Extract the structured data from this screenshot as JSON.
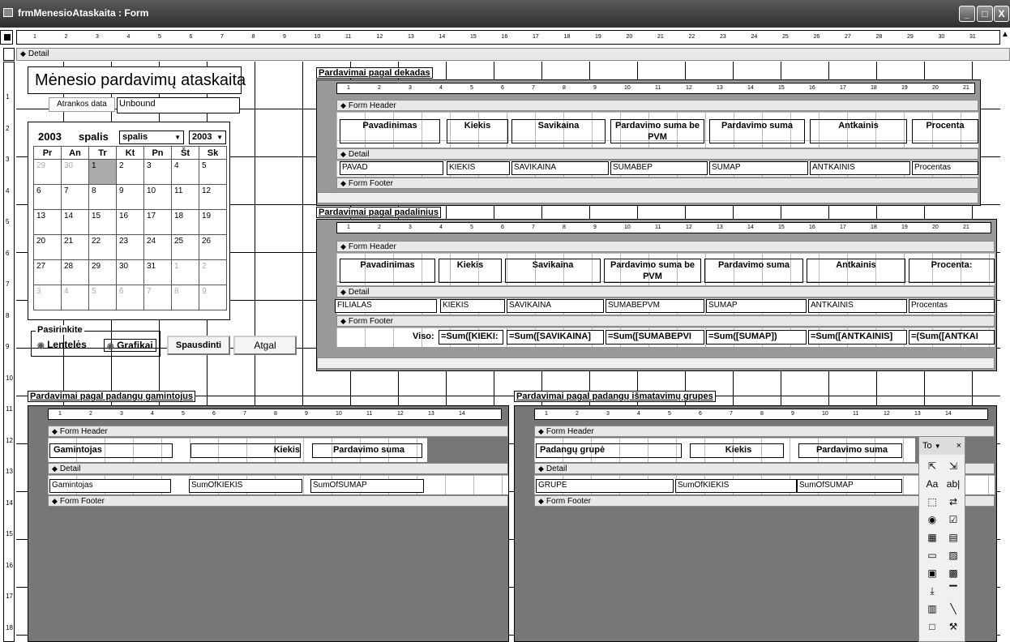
{
  "window": {
    "title": "frmMenesioAtaskaita : Form",
    "buttons": [
      "_",
      "□",
      "X"
    ]
  },
  "ruler_numbers": [
    "1",
    "2",
    "3",
    "4",
    "5",
    "6",
    "7",
    "8",
    "9",
    "10",
    "11",
    "12",
    "13",
    "14",
    "15",
    "16",
    "17",
    "18",
    "19",
    "20",
    "21",
    "22",
    "23",
    "24",
    "25",
    "26",
    "27",
    "28",
    "29",
    "30",
    "31"
  ],
  "vruler_numbers": [
    "1",
    "2",
    "3",
    "4",
    "5",
    "6",
    "7",
    "8",
    "9",
    "10",
    "11",
    "12",
    "13",
    "14",
    "15",
    "16",
    "17",
    "18"
  ],
  "sections": {
    "detail": "Detail",
    "form_header": "Form Header",
    "form_footer": "Form Footer"
  },
  "main": {
    "title": "Mėnesio pardavimų ataskaita",
    "date_label": "Atrankos data",
    "date_value": "Unbound",
    "calendar": {
      "year": "2003",
      "month": "spalis",
      "month_select": "spalis",
      "year_select": "2003",
      "weekdays": [
        "Pr",
        "An",
        "Tr",
        "Kt",
        "Pn",
        "Št",
        "Sk"
      ],
      "weeks": [
        [
          "29",
          "30",
          "1",
          "2",
          "3",
          "4",
          "5"
        ],
        [
          "6",
          "7",
          "8",
          "9",
          "10",
          "11",
          "12"
        ],
        [
          "13",
          "14",
          "15",
          "16",
          "17",
          "18",
          "19"
        ],
        [
          "20",
          "21",
          "22",
          "23",
          "24",
          "25",
          "26"
        ],
        [
          "27",
          "28",
          "29",
          "30",
          "31",
          "1",
          "2"
        ],
        [
          "3",
          "4",
          "5",
          "6",
          "7",
          "8",
          "9"
        ]
      ]
    },
    "option_group": {
      "label": "Pasirinkite",
      "options": [
        "Lentelės",
        "Grafikai"
      ]
    },
    "print_button": "Spausdinti",
    "back_button": "Atgal"
  },
  "subform_decades": {
    "caption": "Pardavimai pagal dekadas",
    "header_labels": [
      "Pavadinimas",
      "Kiekis",
      "Savikaina",
      "Pardavimo suma be PVM",
      "Pardavimo suma",
      "Antkainis",
      "Procenta"
    ],
    "detail_fields": [
      "PAVAD",
      "KIEKIS",
      "SAVIKAINA",
      "SUMABEP",
      "SUMAP",
      "ANTKAINIS",
      "Procentas"
    ]
  },
  "subform_branches": {
    "caption": "Pardavimai pagal padalinius",
    "header_labels": [
      "Pavadinimas",
      "Kiekis",
      "Savikaina",
      "Pardavimo suma be PVM",
      "Pardavimo suma",
      "Antkainis",
      "Procenta:"
    ],
    "detail_fields": [
      "FILIALAS",
      "KIEKIS",
      "SAVIKAINA",
      "SUMABEPVM",
      "SUMAP",
      "ANTKAINIS",
      "Procentas"
    ],
    "footer_label": "Viso:",
    "footer_fields": [
      "=Sum([KIEKI:",
      "=Sum([SAVIKAINA]",
      "=Sum([SUMABEPVI",
      "=Sum([SUMAP])",
      "=Sum([ANTKAINIS]",
      "=(Sum([ANTKAI"
    ]
  },
  "subform_manufacturer": {
    "caption": "Pardavimai pagal padangų gamintojus",
    "header_labels": [
      "Gamintojas",
      "Kiekis",
      "Pardavimo suma"
    ],
    "detail_fields": [
      "Gamintojas",
      "SumOfKIEKIS",
      "SumOfSUMAP"
    ]
  },
  "subform_size": {
    "caption": "Pardavimai pagal padangų išmatavimų grupes",
    "header_labels": [
      "Padangų grupė",
      "Kiekis",
      "Pardavimo suma"
    ],
    "detail_fields": [
      "GRUPE",
      "SumOfKIEKIS",
      "SumOfSUMAP"
    ]
  },
  "toolbox": {
    "title": "To",
    "close": "×",
    "tools": [
      "pointer-icon",
      "wizard-icon",
      "label-icon",
      "textbox-icon",
      "option-group-icon",
      "toggle-icon",
      "option-icon",
      "checkbox-icon",
      "combobox-icon",
      "listbox-icon",
      "command-button-icon",
      "image-icon",
      "unbound-object-icon",
      "bound-object-icon",
      "page-break-icon",
      "tab-control-icon",
      "subform-icon",
      "line-icon",
      "rectangle-icon",
      "more-controls-icon"
    ],
    "glyphs": [
      "⇱",
      "⇲",
      "Aa",
      "ab|",
      "⬚",
      "⇄",
      "◉",
      "☑",
      "▦",
      "▤",
      "▭",
      "▨",
      "▣",
      "▩",
      "⤓",
      "▔",
      "▥",
      "╲",
      "□",
      "⚒"
    ]
  },
  "colors": {
    "title_bar": "#3a3a3a",
    "section_bar": "#e8e8e8",
    "subform_back": "#777777",
    "selected_day": "#aaaaaa"
  }
}
